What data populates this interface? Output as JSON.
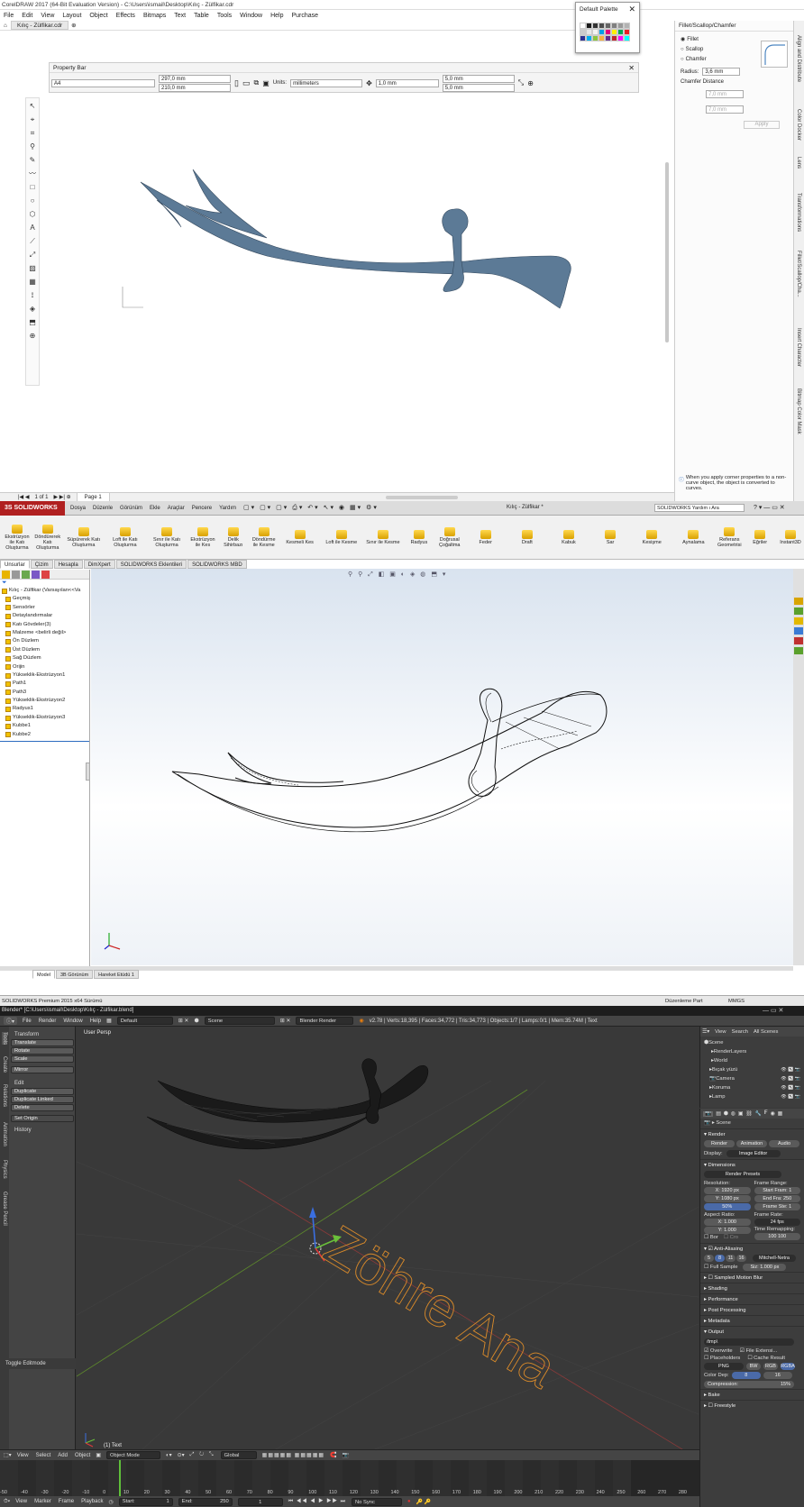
{
  "coreldraw": {
    "title": "CorelDRAW 2017 (64-Bit Evaluation Version) - C:\\Users\\ismail\\Desktop\\Kılıç - Zülfikar.cdr",
    "menu": [
      "File",
      "Edit",
      "View",
      "Layout",
      "Object",
      "Effects",
      "Bitmaps",
      "Text",
      "Table",
      "Tools",
      "Window",
      "Help",
      "Purchase"
    ],
    "doc_tab": "Kılıç - Zülfikar.cdr",
    "palette_title": "Default Palette",
    "palette_colors": [
      "#ffffff",
      "#1a1a1a",
      "#333333",
      "#4d4d4d",
      "#666666",
      "#808080",
      "#999999",
      "#b3b3b3",
      "#cccccc",
      "#e6e6e6",
      "#f2f2f2",
      "#00a0e9",
      "#e4007f",
      "#fff100",
      "#00a651",
      "#ec1c24",
      "#2e3192",
      "#00aeef",
      "#8dc63f",
      "#fbb040",
      "#662d91",
      "#c1272d",
      "#ff00ff",
      "#00ffff"
    ],
    "property_bar": {
      "title": "Property Bar",
      "page_size": "A4",
      "width": "297,0 mm",
      "height": "210,0 mm",
      "units_label": "Units:",
      "units": "millimeters",
      "nudge": "1,0 mm",
      "dup_x": "5,0 mm",
      "dup_y": "5,0 mm"
    },
    "docker": {
      "title": "Fillet/Scallop/Chamfer",
      "options": [
        "Fillet",
        "Scallop",
        "Chamfer"
      ],
      "selected": "Fillet",
      "radius_label": "Radius:",
      "radius": "3,6 mm",
      "chamfer_distance": "Chamfer Distance",
      "chamfer_1": "7,0 mm",
      "chamfer_2": "7,0 mm",
      "apply": "Apply",
      "info": "When you apply corner properties to a non-curve object, the object is converted to curves."
    },
    "dock_tabs": [
      "Align and Distribute",
      "Color Docker",
      "Lens",
      "Transformations",
      "Fillet/Scallop/Cha...",
      "Insert Character",
      "Bitmap Color Mask"
    ],
    "page_nav": "1 of 1",
    "page_label": "Page 1"
  },
  "solidworks": {
    "logo": "3S SOLIDWORKS",
    "menu": [
      "Dosya",
      "Düzenle",
      "Görünüm",
      "Ekle",
      "Araçlar",
      "Pencere",
      "Yardım"
    ],
    "doc_title": "Kılıç - Zülfikar *",
    "search_placeholder": "SOLIDWORKS Yardım ı Ara",
    "ribbon": [
      {
        "label": "Ekstrüzyon ile Katı Oluşturma"
      },
      {
        "label": "Döndürerek Katı Oluşturma"
      },
      {
        "label": "Süpürerek Katı Oluşturma"
      },
      {
        "label": "Loft ile Katı Oluşturma"
      },
      {
        "label": "Sınır ile Katı Oluşturma"
      },
      {
        "label": "Ekstrüzyon ile Kes"
      },
      {
        "label": "Delik Sihirbazı"
      },
      {
        "label": "Döndürme ile Kesme"
      },
      {
        "label": "Kesmeli Kes"
      },
      {
        "label": "Loft ile Kesme"
      },
      {
        "label": "Sınır ile Kesme"
      },
      {
        "label": "Radyus"
      },
      {
        "label": "Doğrusal Çoğaltma"
      },
      {
        "label": "Feder"
      },
      {
        "label": "Draft"
      },
      {
        "label": "Kabuk"
      },
      {
        "label": "Sar"
      },
      {
        "label": "Kesişme"
      },
      {
        "label": "Aynalama"
      },
      {
        "label": "Referans Geometrisi"
      },
      {
        "label": "Eğriler"
      },
      {
        "label": "Instant3D"
      }
    ],
    "tabs": [
      "Unsurlar",
      "Çizim",
      "Hesapla",
      "DimXpert",
      "SOLIDWORKS Eklentileri",
      "SOLIDWORKS MBD"
    ],
    "tree": [
      "Kılıç - Zülfikar  (Varsayılan<<Va",
      "Geçmiş",
      "Sensörler",
      "Detaylandırmalar",
      "Katı Gövdeler(3)",
      "Malzeme <belirli değil>",
      "Ön Düzlem",
      "Üst Düzlem",
      "Sağ Düzlem",
      "Orijin",
      "Yükseklik-Ekstrüzyon1",
      "Path1",
      "Path3",
      "Yükseklik-Ekstrüzyon2",
      "Radyus1",
      "Yükseklik-Ekstrüzyon3",
      "Kubbe1",
      "Kubbe2"
    ],
    "bottom_tabs": [
      "Model",
      "3B Görünüm",
      "Hareket Etüdü 1"
    ],
    "status_left": "SOLIDWORKS Premium 2015 x64 Sürümü",
    "status_mid": "Düzenleme Part",
    "status_units": "MMGS"
  },
  "blender": {
    "title": "Blender* [C:\\Users\\ismail\\Desktop\\Kılıç - Zülfikar.blend]",
    "menu": [
      "File",
      "Render",
      "Window",
      "Help"
    ],
    "layout": "Default",
    "scene": "Scene",
    "engine": "Blender Render",
    "stats": "v2.78 | Verts:18,395 | Faces:34,772 | Tris:34,773 | Objects:1/7 | Lamps:0/1 | Mem:35.74M | Text",
    "view_label": "User Persp",
    "object_label": "(1) Text",
    "text_object": "Zöhre Ana",
    "tool_sections": {
      "transform": "Transform",
      "transform_buttons": [
        "Translate",
        "Rotate",
        "Scale",
        "Mirror"
      ],
      "edit": "Edit",
      "edit_buttons": [
        "Duplicate",
        "Duplicate Linked",
        "Delete"
      ],
      "set_origin": "Set Origin",
      "history": "History",
      "toggle_editmode": "Toggle Editmode"
    },
    "tool_tabs": [
      "Tools",
      "Create",
      "Relations",
      "Animation",
      "Physics",
      "Grease Pencil"
    ],
    "outliner": {
      "header": [
        "View",
        "Search",
        "All Scenes"
      ],
      "items": [
        "Scene",
        "RenderLayers",
        "World",
        "Bıçak yüzü",
        "Camera",
        "Koruma",
        "Lamp"
      ]
    },
    "render": {
      "scene_label": "Scene",
      "render_header": "Render",
      "buttons": [
        "Render",
        "Animation",
        "Audio"
      ],
      "display_label": "Display:",
      "display": "Image Editor",
      "dimensions": "Dimensions",
      "presets": "Render Presets",
      "resolution": "Resolution:",
      "res_x": "X:  1920 px",
      "res_y": "Y:  1080 px",
      "res_pct": "50%",
      "frame_range": "Frame Range:",
      "start": "Start Fram: 1",
      "end": "End Fra: 250",
      "step": "Frame Ste: 1",
      "aspect": "Aspect Ratio:",
      "ax": "X:  1.000",
      "ay": "Y:  1.000",
      "frame_rate": "Frame Rate:",
      "fps": "24 fps",
      "time_remap": "Time Remapping:",
      "remap": "100  100",
      "bor": "Bor",
      "cro": "Cro",
      "aa": "Anti-Aliasing",
      "aa_samples": [
        "5",
        "8",
        "11",
        "16"
      ],
      "aa_filter": "Mitchell-Netra",
      "full_sample": "Full Sample",
      "size": "Siz: 1.000 px",
      "sections": [
        "Sampled Motion Blur",
        "Shading",
        "Performance",
        "Post Processing",
        "Metadata",
        "Output"
      ],
      "output_path": "/tmp\\",
      "overwrite": "Overwrite",
      "file_ext": "File Extensi...",
      "placeholders": "Placeholders",
      "cache": "Cache Result",
      "format": "PNG",
      "color_modes": [
        "BW",
        "RGB",
        "RGBA"
      ],
      "color_depth": "Color Dep:",
      "depths": [
        "8",
        "16"
      ],
      "compression": "Compression:",
      "compression_val": "15%",
      "bake": "Bake",
      "freestyle": "Freestyle"
    },
    "view_header": [
      "View",
      "Select",
      "Add",
      "Object"
    ],
    "mode": "Object Mode",
    "orientation": "Global",
    "timeline_header": [
      "View",
      "Marker",
      "Frame",
      "Playback"
    ],
    "tl_start": "Start:",
    "tl_start_v": "1",
    "tl_end": "End:",
    "tl_end_v": "250",
    "tl_cur": "1",
    "sync": "No Sync",
    "ticks": [
      "-50",
      "-40",
      "-30",
      "-20",
      "-10",
      "0",
      "10",
      "20",
      "30",
      "40",
      "50",
      "60",
      "70",
      "80",
      "90",
      "100",
      "110",
      "120",
      "130",
      "140",
      "150",
      "160",
      "170",
      "180",
      "190",
      "200",
      "210",
      "220",
      "230",
      "240",
      "250",
      "260",
      "270",
      "280"
    ]
  },
  "colors": {
    "sword_fill": "#5c7a96",
    "sw_red": "#b02020",
    "blender_orange": "#d98a2a"
  }
}
